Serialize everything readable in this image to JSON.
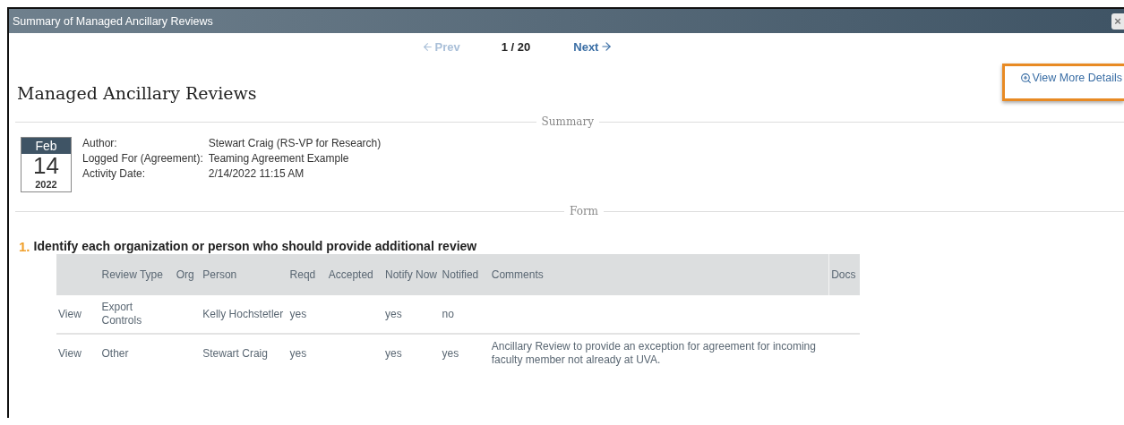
{
  "window": {
    "title": "Summary of Managed Ancillary Reviews",
    "close": "×"
  },
  "pager": {
    "prev": {
      "label": "Prev",
      "disabled": true
    },
    "position": "1 / 20",
    "next": {
      "label": "Next",
      "disabled": false
    }
  },
  "details_link": {
    "label": "View More Details",
    "highlighted": true
  },
  "heading": "Managed Ancillary Reviews",
  "summary": {
    "legend": "Summary",
    "date": {
      "month": "Feb",
      "day": "14",
      "year": "2022"
    },
    "fields": [
      {
        "label": "Author:",
        "value": "Stewart Craig (RS-VP for Research)"
      },
      {
        "label": "Logged For (Agreement):",
        "value": "Teaming Agreement Example"
      },
      {
        "label": "Activity Date:",
        "value": "2/14/2022 11:15 AM"
      }
    ]
  },
  "form": {
    "legend": "Form",
    "question": {
      "number": "1.",
      "text": "Identify each organization or person who should provide additional review"
    },
    "table": {
      "columns": [
        "",
        "Review Type",
        "Org",
        "Person",
        "Reqd",
        "Accepted",
        "Notify Now",
        "Notified",
        "Comments",
        "Docs"
      ],
      "rows": [
        [
          "View",
          "Export Controls",
          "",
          "Kelly Hochstetler",
          "yes",
          "",
          "yes",
          "no",
          "",
          ""
        ],
        [
          "View",
          "Other",
          "",
          "Stewart Craig",
          "yes",
          "",
          "yes",
          "yes",
          "Ancillary Review to provide an exception for agreement for incoming faculty member not already at UVA.",
          ""
        ]
      ]
    }
  }
}
